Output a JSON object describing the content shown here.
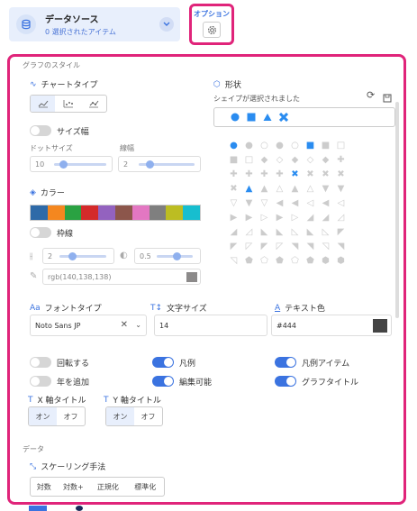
{
  "datasource": {
    "title": "データソース",
    "subtitle": "0 選択されたアイテム"
  },
  "options": {
    "label": "オプション"
  },
  "graph_style": "グラフのスタイル",
  "chart_type": {
    "label": "チャートタイプ"
  },
  "size_width": {
    "label": "サイズ幅",
    "dot_size_label": "ドットサイズ",
    "line_width_label": "線幅",
    "dot_size": "10",
    "line_width": "2"
  },
  "color": {
    "label": "カラー",
    "palette": [
      "#2e6aa8",
      "#f4871f",
      "#2aa242",
      "#d42a2a",
      "#9362bf",
      "#8c564b",
      "#e377c2",
      "#7f7f7f",
      "#bcbd22",
      "#17becf"
    ]
  },
  "border": {
    "label": "枠線",
    "width": "2",
    "opacity": "0.5",
    "color_value": "rgb(140,138,138)"
  },
  "shape": {
    "label": "形状",
    "selected_text": "シェイプが選択されました"
  },
  "font_type": {
    "label": "フォントタイプ",
    "value": "Noto Sans JP"
  },
  "font_size": {
    "label": "文字サイズ",
    "value": "14"
  },
  "text_color": {
    "label": "テキスト色",
    "value": "#444"
  },
  "toggles": {
    "rotate": "回転する",
    "legend": "凡例",
    "legend_items": "凡例アイテム",
    "add_year": "年を追加",
    "editable": "編集可能",
    "graph_title": "グラフタイトル"
  },
  "x_axis_title": {
    "label": "X 軸タイトル",
    "on": "オン",
    "off": "オフ"
  },
  "y_axis_title": {
    "label": "Y 軸タイトル",
    "on": "オン",
    "off": "オフ"
  },
  "data_section": "データ",
  "scaling": {
    "label": "スケーリング手法",
    "options": [
      "対数",
      "対数+",
      "正規化",
      "標準化"
    ]
  },
  "colors": {
    "accent": "#3b73e0",
    "highlight": "#e0247a"
  }
}
